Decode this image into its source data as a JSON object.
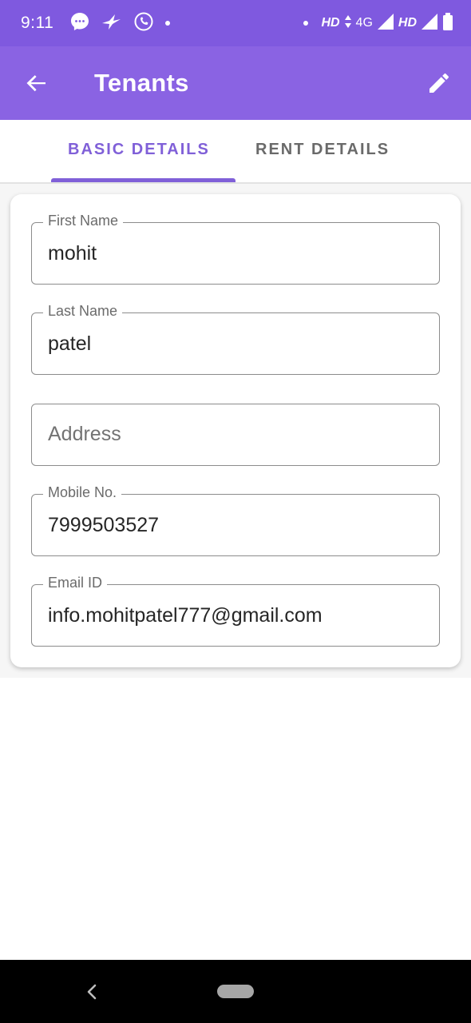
{
  "status_bar": {
    "time": "9:11",
    "network_left": "HD",
    "network_type": "4G",
    "network_right": "HD",
    "icons": [
      "messenger-icon",
      "bird-icon",
      "call-icon",
      "dot-icon",
      "dot-icon",
      "data-arrows-icon",
      "signal-icon",
      "signal-icon",
      "battery-icon"
    ]
  },
  "app_bar": {
    "title": "Tenants",
    "back_icon": "arrow-back-icon",
    "edit_icon": "pencil-icon",
    "color": "#8a63e3"
  },
  "tabs": [
    {
      "label": "BASIC DETAILS",
      "active": true
    },
    {
      "label": "RENT DETAILS",
      "active": false
    }
  ],
  "form": {
    "first_name": {
      "label": "First Name",
      "value": "mohit"
    },
    "last_name": {
      "label": "Last Name",
      "value": "patel"
    },
    "address": {
      "placeholder": "Address",
      "value": ""
    },
    "mobile": {
      "label": "Mobile No.",
      "value": "7999503527"
    },
    "email": {
      "label": "Email ID",
      "value": "info.mohitpatel777@gmail.com"
    }
  },
  "accent_color": "#8060d8"
}
